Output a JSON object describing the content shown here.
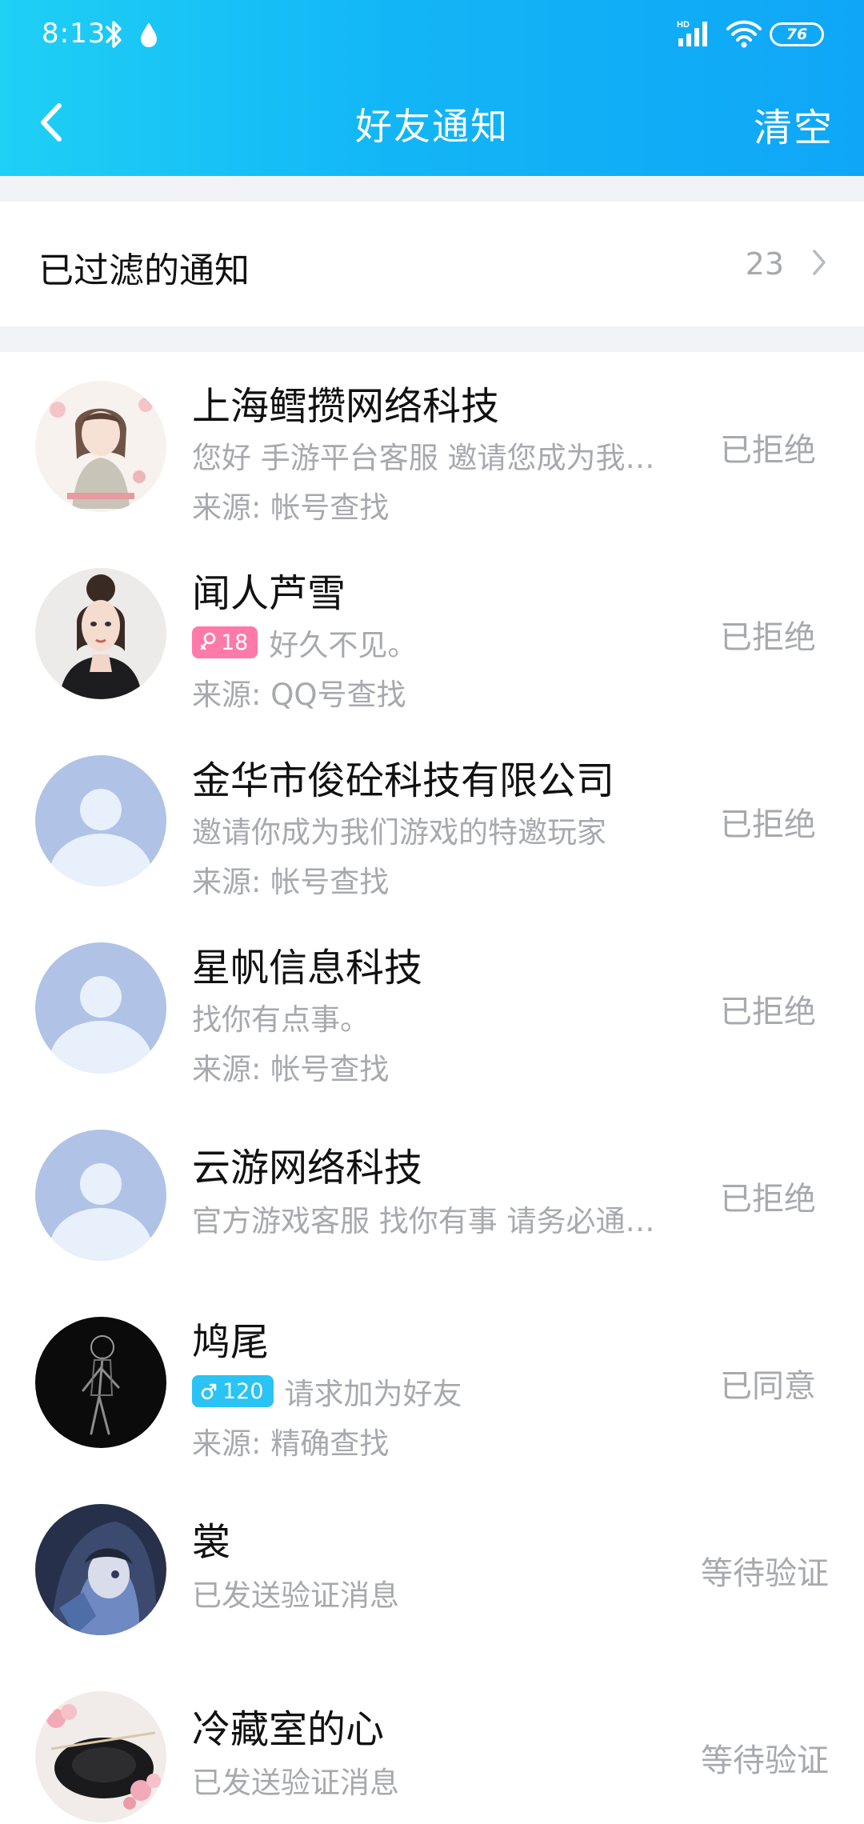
{
  "status_bar": {
    "time": "8:13",
    "battery": "76",
    "signal_label": "HD"
  },
  "header": {
    "title": "好友通知",
    "clear_label": "清空"
  },
  "filtered": {
    "label": "已过滤的通知",
    "count": "23"
  },
  "notifications": [
    {
      "name": "上海鳕攒网络科技",
      "message": "您好 手游平台客服 邀请您成为我…",
      "source": "来源: 帐号查找",
      "status": "已拒绝",
      "avatar": "anime-girl-avatar"
    },
    {
      "name": "闻人芦雪",
      "badge": "18",
      "gender": "female",
      "message": "好久不见。",
      "source": "来源: QQ号查找",
      "status": "已拒绝",
      "avatar": "woman-photo-avatar"
    },
    {
      "name": "金华市俊砼科技有限公司",
      "message": "邀请你成为我们游戏的特邀玩家",
      "source": "来源: 帐号查找",
      "status": "已拒绝",
      "avatar": "default-avatar"
    },
    {
      "name": "星帆信息科技",
      "message": "找你有点事。",
      "source": "来源: 帐号查找",
      "status": "已拒绝",
      "avatar": "default-avatar"
    },
    {
      "name": "云游网络科技",
      "message": "官方游戏客服 找你有事 请务必通…",
      "source": "",
      "status": "已拒绝",
      "avatar": "default-avatar"
    },
    {
      "name": "鸠尾",
      "badge": "120",
      "gender": "male",
      "message": "请求加为好友",
      "source": "来源: 精确查找",
      "status": "已同意",
      "avatar": "dark-figure-avatar"
    },
    {
      "name": "裳",
      "message": "已发送验证消息",
      "source": "",
      "status": "等待验证",
      "avatar": "anime-hood-avatar"
    },
    {
      "name": "冷藏室的心",
      "message": "已发送验证消息",
      "source": "",
      "status": "等待验证",
      "avatar": "flower-plate-avatar"
    }
  ],
  "colors": {
    "header_start": "#1fd0f5",
    "header_end": "#0fa6f7",
    "secondary_text": "#a7a9ad",
    "female_badge": "#ff7aa8",
    "male_badge": "#29c3f4",
    "default_avatar": "#b0c3e6"
  }
}
